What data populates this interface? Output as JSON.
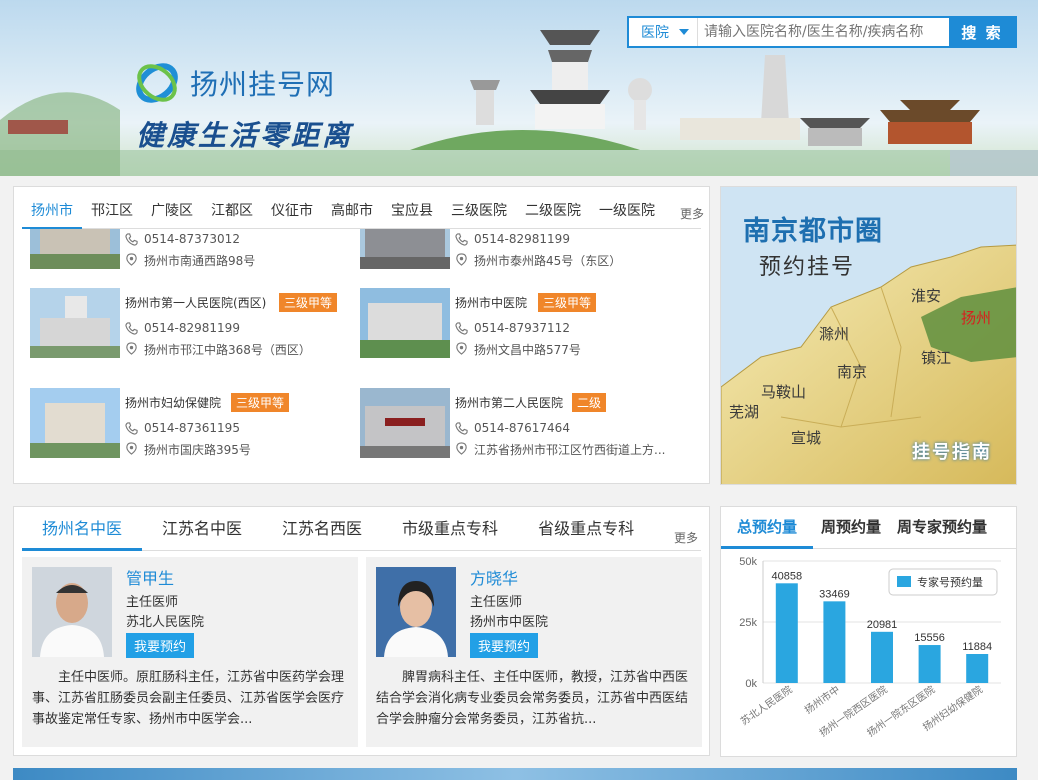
{
  "header": {
    "logo_text": "扬州挂号网",
    "slogan": "健康生活零距离",
    "search": {
      "category": "医院",
      "placeholder": "请输入医院名称/医生名称/疾病名称",
      "button": "搜 索"
    }
  },
  "hospital_tabs": {
    "items": [
      "扬州市",
      "邗江区",
      "广陵区",
      "江都区",
      "仪征市",
      "高邮市",
      "宝应县",
      "三级医院",
      "二级医院",
      "一级医院"
    ],
    "active": 0,
    "more": "更多"
  },
  "hospitals": [
    {
      "name": "",
      "badge": "",
      "phone": "0514-87373012",
      "address": "扬州市南通西路98号"
    },
    {
      "name": "",
      "badge": "",
      "phone": "0514-82981199",
      "address": "扬州市泰州路45号（东区）"
    },
    {
      "name": "扬州市第一人民医院(西区)",
      "badge": "三级甲等",
      "phone": "0514-82981199",
      "address": "扬州市邗江中路368号（西区）"
    },
    {
      "name": "扬州市中医院",
      "badge": "三级甲等",
      "phone": "0514-87937112",
      "address": "扬州文昌中路577号"
    },
    {
      "name": "扬州市妇幼保健院",
      "badge": "三级甲等",
      "phone": "0514-87361195",
      "address": "扬州市国庆路395号"
    },
    {
      "name": "扬州市第二人民医院",
      "badge": "二级",
      "phone": "0514-87617464",
      "address": "江苏省扬州市邗江区竹西街道上方..."
    }
  ],
  "ad": {
    "title": "南京都市圈",
    "subtitle": "预约挂号",
    "link": "挂号指南",
    "cities": [
      "淮安",
      "扬州",
      "滁州",
      "南京",
      "镇江",
      "马鞍山",
      "芜湖",
      "宣城"
    ]
  },
  "doctor_tabs": {
    "items": [
      "扬州名中医",
      "江苏名中医",
      "江苏名西医",
      "市级重点专科",
      "省级重点专科"
    ],
    "active": 0,
    "more": "更多"
  },
  "doctors": [
    {
      "name": "管甲生",
      "title": "主任医师",
      "hospital": "苏北人民医院",
      "button": "我要预约",
      "desc": "主任中医师。原肛肠科主任，江苏省中医药学会理事、江苏省肛肠委员会副主任委员、江苏省医学会医疗事故鉴定常任专家、扬州市中医学会..."
    },
    {
      "name": "方晓华",
      "title": "主任医师",
      "hospital": "扬州市中医院",
      "button": "我要预约",
      "desc": "脾胃病科主任、主任中医师，教授，江苏省中西医结合学会消化病专业委员会常务委员，江苏省中西医结合学会肿瘤分会常务委员，江苏省抗..."
    }
  ],
  "stats_tabs": {
    "items": [
      "总预约量",
      "周预约量",
      "周专家预约量"
    ],
    "active": 0
  },
  "chart_data": {
    "type": "bar",
    "categories": [
      "苏北人民医院",
      "扬州市中",
      "扬州一院西区医院",
      "扬州一院东区医院",
      "扬州妇幼保健院"
    ],
    "series": [
      {
        "name": "专家号预约量",
        "values": [
          40858,
          33469,
          20981,
          15556,
          11884
        ]
      }
    ],
    "yticks": [
      "0k",
      "25k",
      "50k"
    ],
    "ylim": [
      0,
      50000
    ],
    "legend": "top-right",
    "bar_color": "#2aa6e0"
  }
}
